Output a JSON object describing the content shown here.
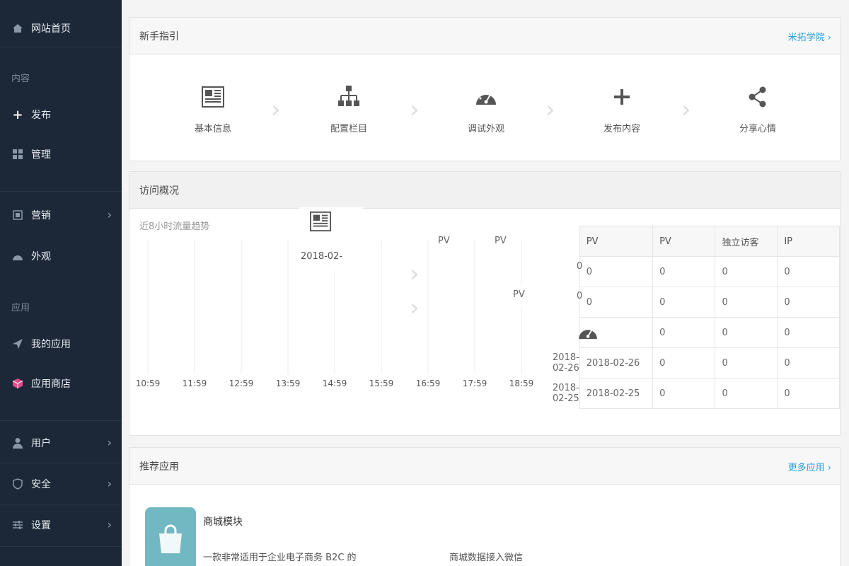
{
  "sidebar": {
    "home": "网站首页",
    "sections": {
      "content": "内容",
      "apps": "应用"
    },
    "items": {
      "publish": "发布",
      "manage": "管理",
      "marketing": "营销",
      "appearance": "外观",
      "my_apps": "我的应用",
      "app_store": "应用商店",
      "users": "用户",
      "security": "安全",
      "settings": "设置"
    }
  },
  "guide": {
    "title": "新手指引",
    "link": "米拓学院 ›",
    "steps": [
      "基本信息",
      "配置栏目",
      "调试外观",
      "发布内容",
      "分享心情"
    ]
  },
  "visits": {
    "title": "访问概况",
    "trend_title": "近8小时流量趋势",
    "ticks": [
      "10:59",
      "11:59",
      "12:59",
      "13:59",
      "14:59",
      "15:59",
      "16:59",
      "17:59",
      "18:59"
    ],
    "overlay": {
      "date": "2018-02-",
      "pv_a": "PV",
      "pv_b": "PV",
      "pv_c": "PV",
      "val": "0"
    },
    "table": {
      "headers": [
        "PV",
        "PV",
        "独立访客",
        "IP"
      ],
      "rows": [
        [
          "",
          "0",
          "0",
          "0",
          "0"
        ],
        [
          "",
          "0",
          "0",
          "0",
          "0"
        ],
        [
          "",
          "",
          "0",
          "0",
          "0"
        ],
        [
          "2018-02-26",
          "",
          "0",
          "0",
          "0"
        ],
        [
          "2018-02-25",
          "",
          "0",
          "0",
          "0"
        ]
      ]
    }
  },
  "recommended": {
    "title": "推荐应用",
    "link": "更多应用 ›",
    "app": {
      "name": "商城模块",
      "desc": "一款非常适用于企业电子商务 B2C 的",
      "desc2": "商城数据接入微信"
    }
  },
  "colors": {
    "sidebar": "#1c2838",
    "accent": "#2a9fd6",
    "app_icon": "#72b8c2"
  }
}
